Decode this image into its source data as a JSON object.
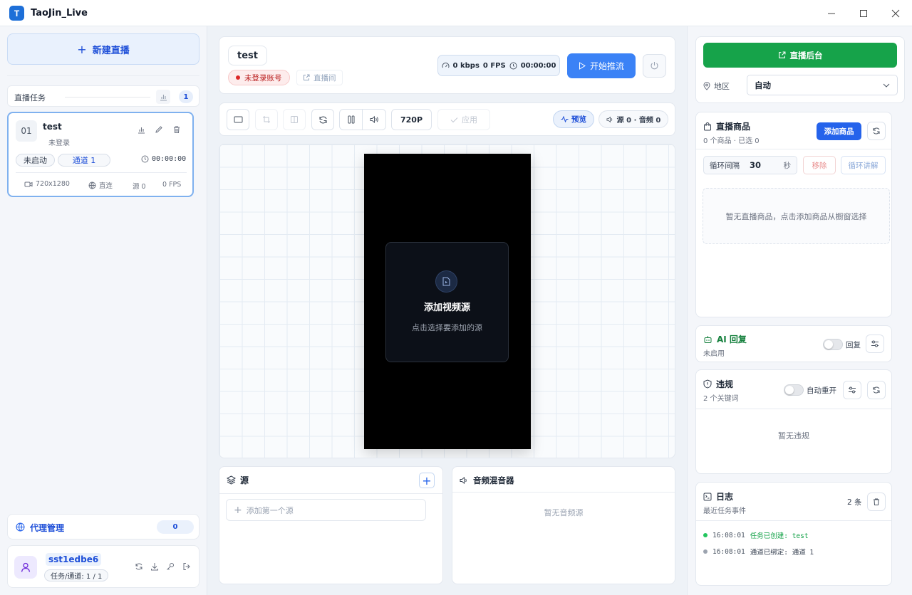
{
  "app": {
    "title": "TaoJin_Live",
    "logo_letter": "T"
  },
  "window_controls": [
    "minimize-icon",
    "maximize-icon",
    "close-icon"
  ],
  "sidebar": {
    "new_live_label": "新建直播",
    "tasks_title": "直播任务",
    "tasks_count": "1",
    "task": {
      "index": "01",
      "name": "test",
      "login_status": "未登录",
      "state": "未启动",
      "channel": "通道 1",
      "time": "00:00:00",
      "resolution": "720x1280",
      "connection": "直连",
      "sources": "源 0",
      "fps": "0 FPS"
    },
    "proxy_title": "代理管理",
    "proxy_count": "0",
    "user": {
      "name": "sst1edbe6",
      "quota": "任务/通道: 1 / 1"
    }
  },
  "stream": {
    "title": "test",
    "account_status": "未登录账号",
    "live_room_link": "直播间",
    "stats": {
      "bitrate": "0 kbps",
      "fps": "0 FPS",
      "time": "00:00:00"
    },
    "start_label": "开始推流"
  },
  "toolbar": {
    "resolution": "720P",
    "apply_label": "应用",
    "preview_label": "预览",
    "source_audio_label": "源 0 · 音频 0"
  },
  "canvas": {
    "placeholder_title": "添加视频源",
    "placeholder_sub": "点击选择要添加的源"
  },
  "sources_panel": {
    "title": "源",
    "add_first": "添加第一个源"
  },
  "mixer_panel": {
    "title": "音频混音器",
    "empty": "暂无音频源"
  },
  "right": {
    "backend_label": "直播后台",
    "region_label": "地区",
    "region_value": "自动",
    "products": {
      "title": "直播商品",
      "summary": "0 个商品 · 已选 0",
      "add_label": "添加商品",
      "loop_label": "循环间隔",
      "loop_value": "30",
      "loop_unit": "秒",
      "remove_label": "移除",
      "explain_label": "循环讲解",
      "empty": "暂无直播商品，点击添加商品从橱窗选择"
    },
    "ai": {
      "title": "AI 回复",
      "status": "未启用",
      "toggle_label": "回复"
    },
    "violation": {
      "title": "违规",
      "keywords": "2 个关键词",
      "toggle_label": "自动重开",
      "empty": "暂无违规"
    },
    "logs": {
      "title": "日志",
      "subtitle": "最近任务事件",
      "count": "2 条",
      "entries": [
        {
          "time": "16:08:01",
          "text": "任务已创建: test",
          "color": "#22c55e"
        },
        {
          "time": "16:08:01",
          "text": "通道已绑定: 通道 1",
          "color": "#9ca3af"
        }
      ]
    }
  },
  "colors": {
    "accent": "#2563eb",
    "start_button": "#3b82f6",
    "backend_button": "#16a34a",
    "danger": "#dc2626",
    "app_icon": "#1d6fd8"
  }
}
